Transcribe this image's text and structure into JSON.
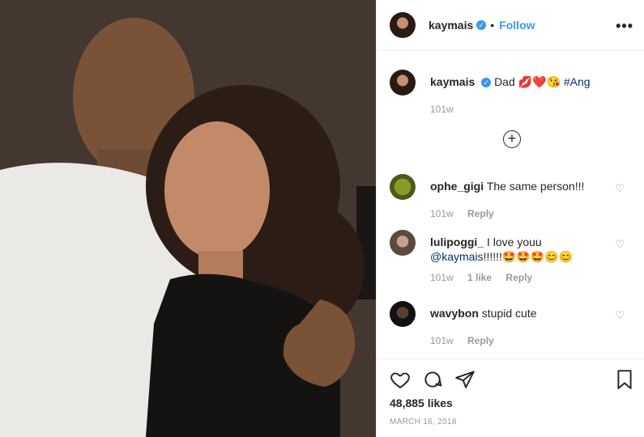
{
  "post": {
    "username": "kaymais",
    "verified_mark": "✓",
    "separator": "•",
    "follow_label": "Follow",
    "more_label": "•••"
  },
  "caption": {
    "username": "kaymais",
    "text": "Dad",
    "emojis": "💋❤️😘",
    "hashtag": "#Ang",
    "age": "101w"
  },
  "load_more_icon": "plus-circle-icon",
  "comments": [
    {
      "username": "ophe_gigi",
      "text": "The same person!!!",
      "age": "101w",
      "likes": "",
      "reply": "Reply"
    },
    {
      "username": "lulipoggi_",
      "text": "I love youu",
      "mention": "@kaymais",
      "suffix": "!!!!!!🤩🤩🤩😊😊",
      "age": "101w",
      "likes": "1 like",
      "reply": "Reply"
    },
    {
      "username": "wavybon",
      "text": "stupid cute",
      "age": "101w",
      "likes": "",
      "reply": "Reply"
    }
  ],
  "actions": {
    "likes": "48,885 likes",
    "date": "MARCH 16, 2018"
  },
  "colors": {
    "link": "#3897f0",
    "muted": "#999999",
    "border": "#efefef",
    "text": "#262626"
  }
}
